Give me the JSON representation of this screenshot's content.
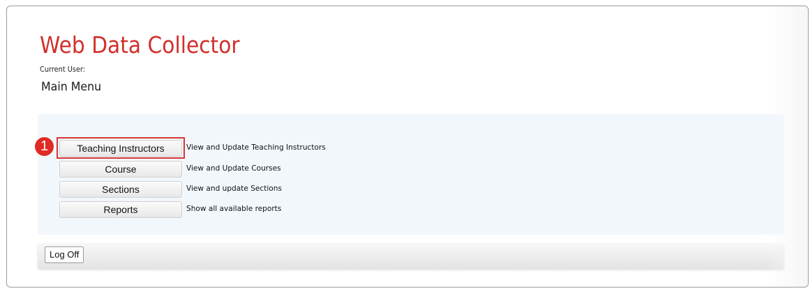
{
  "app": {
    "title": "Web Data Collector",
    "title_color": "#d0302b",
    "current_user_label": "Current User:",
    "page_title": "Main Menu"
  },
  "menu": {
    "items": [
      {
        "button": "Teaching Instructors",
        "description": "View and Update Teaching Instructors"
      },
      {
        "button": "Course",
        "description": "View and Update Courses"
      },
      {
        "button": "Sections",
        "description": "View and update Sections"
      },
      {
        "button": "Reports",
        "description": "Show all available reports"
      }
    ]
  },
  "annotation": {
    "step_number": "1",
    "color": "#e02a25"
  },
  "footer": {
    "logoff_label": "Log Off"
  }
}
